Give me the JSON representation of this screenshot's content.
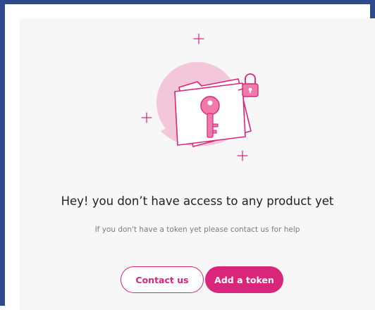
{
  "empty_state": {
    "title": "Hey! you don’t have access to any product yet",
    "subtitle": "If you don't have a token yet please contact us for help",
    "illustration_icon": "locked-folder-key-icon"
  },
  "actions": {
    "contact_label": "Contact us",
    "add_token_label": "Add a token"
  },
  "colors": {
    "accent": "#d9257a",
    "accent_light": "#f3c6d9",
    "frame_border": "#2f4a8c",
    "card_background": "#f8f7f7",
    "title_text": "#1f1f24",
    "muted_text": "#7b7b82"
  }
}
